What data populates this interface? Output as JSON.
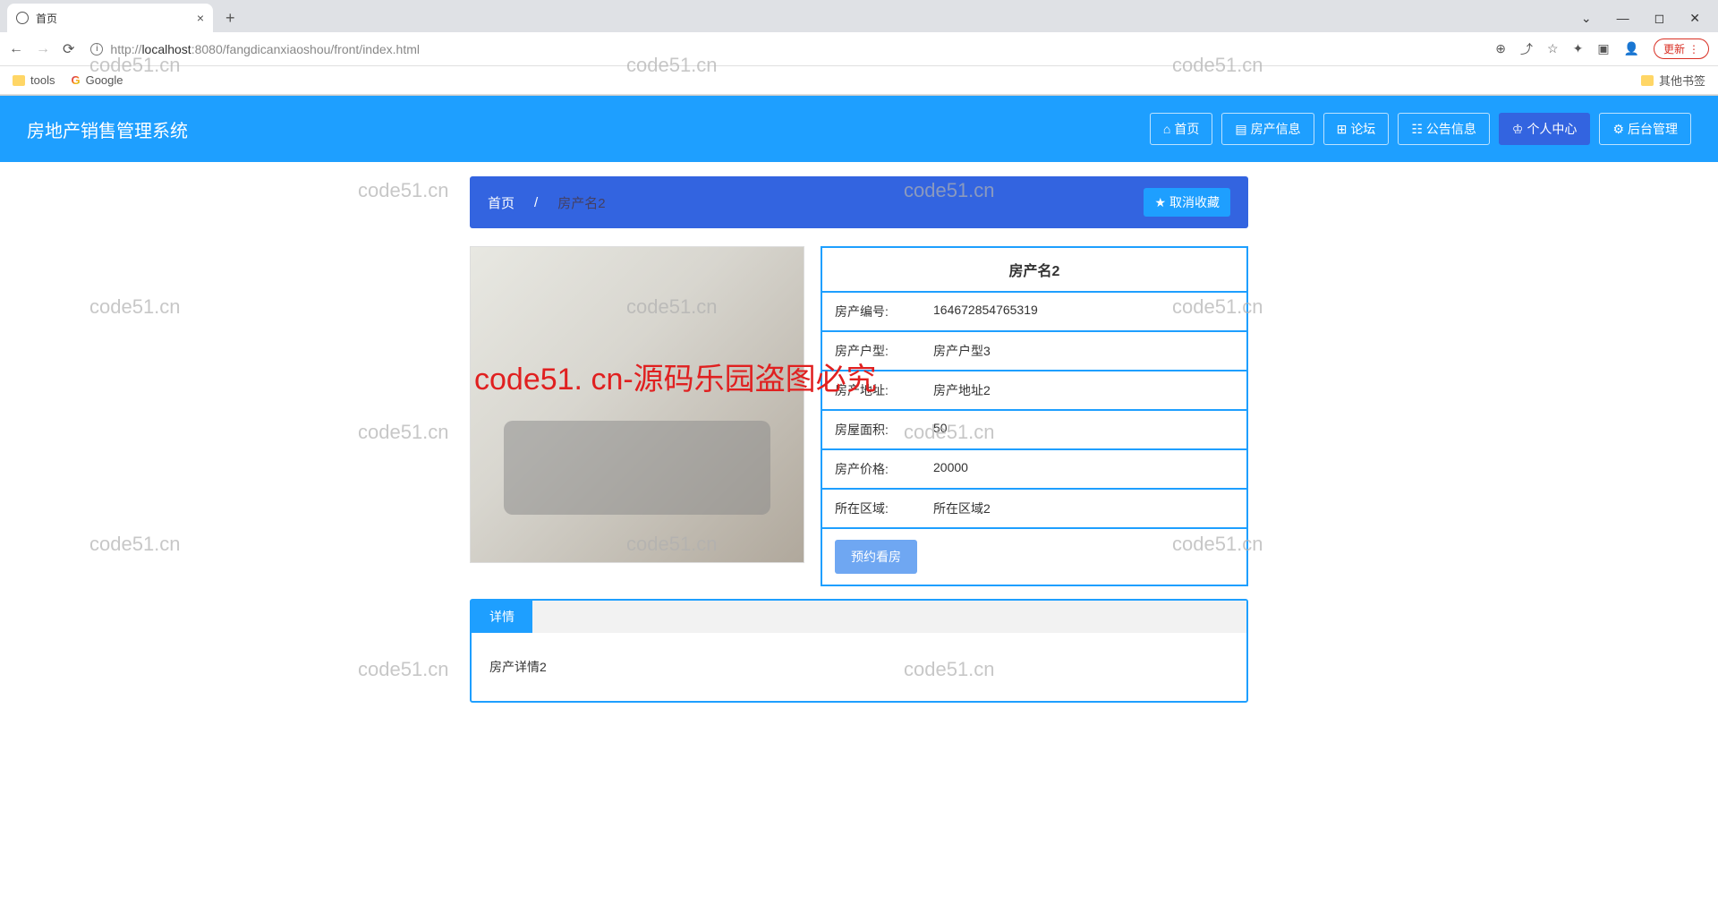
{
  "browser": {
    "tab_title": "首页",
    "url_proto": "http://",
    "url_host": "localhost",
    "url_port": ":8080",
    "url_path": "/fangdicanxiaoshou/front/index.html",
    "update_text": "更新",
    "bookmarks": {
      "tools": "tools",
      "google": "Google",
      "other": "其他书签"
    }
  },
  "header": {
    "title": "房地产销售管理系统",
    "nav": {
      "home": "首页",
      "property": "房产信息",
      "forum": "论坛",
      "announce": "公告信息",
      "personal": "个人中心",
      "admin": "后台管理"
    }
  },
  "breadcrumb": {
    "home": "首页",
    "sep": "/",
    "current": "房产名2",
    "btn": "取消收藏"
  },
  "property": {
    "title": "房产名2",
    "rows": [
      {
        "label": "房产编号:",
        "value": "164672854765319"
      },
      {
        "label": "房产户型:",
        "value": "房产户型3"
      },
      {
        "label": "房产地址:",
        "value": "房产地址2"
      },
      {
        "label": "房屋面积:",
        "value": "50"
      },
      {
        "label": "房产价格:",
        "value": "20000"
      },
      {
        "label": "所在区域:",
        "value": "所在区域2"
      }
    ],
    "action": "预约看房"
  },
  "detail_tab": {
    "label": "详情",
    "content": "房产详情2"
  },
  "watermarks": {
    "text": "code51.cn",
    "red": "code51. cn-源码乐园盗图必究"
  }
}
